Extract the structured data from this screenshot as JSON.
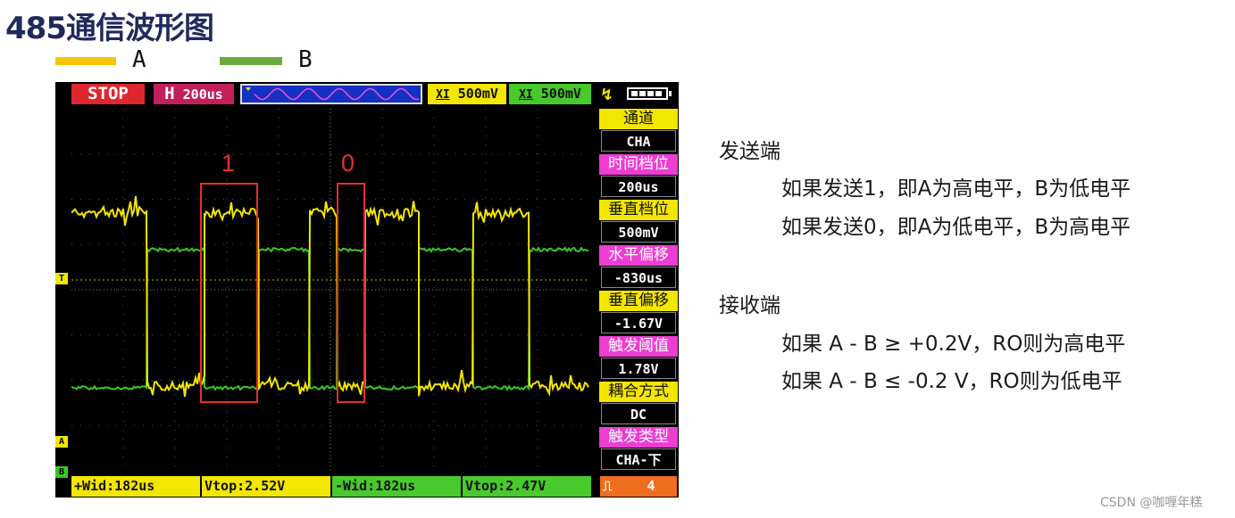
{
  "title": "485通信波形图",
  "legend": [
    {
      "label": "A",
      "color": "#f7c400"
    },
    {
      "label": "B",
      "color": "#6aab3d"
    }
  ],
  "scope": {
    "status": "STOP",
    "timebase_prefix": "H",
    "timebase": "200us",
    "ch1_scale": "500mV",
    "ch2_scale": "500mV",
    "ch_prefix": "XI",
    "marker_trigger": "T",
    "marker_a": "A",
    "marker_b": "B",
    "bit_label_1": "1",
    "bit_label_0": "0",
    "colors": {
      "ch_a": "#f3e600",
      "ch_b": "#3cc52b",
      "highlight": "#e5302a",
      "grid": "#555555"
    },
    "panel": [
      {
        "label": "通道",
        "value": "CHA",
        "label_bg": "#f3e600"
      },
      {
        "label": "时间档位",
        "value": "200us",
        "label_bg": "#ec3ed2"
      },
      {
        "label": "垂直档位",
        "value": "500mV",
        "label_bg": "#f3e600"
      },
      {
        "label": "水平偏移",
        "value": "-830us",
        "label_bg": "#ec3ed2"
      },
      {
        "label": "垂直偏移",
        "value": "-1.67V",
        "label_bg": "#f3e600"
      },
      {
        "label": "触发阈值",
        "value": "1.78V",
        "label_bg": "#ec3ed2"
      },
      {
        "label": "耦合方式",
        "value": "DC",
        "label_bg": "#f3e600"
      },
      {
        "label": "触发类型",
        "value": "CHA-下",
        "label_bg": "#ec3ed2"
      }
    ],
    "bottom": {
      "pwid": "+Wid:182us",
      "vtop_a": "Vtop:2.52V",
      "nwid": "-Wid:182us",
      "vtop_b": "Vtop:2.47V",
      "count_icon": "⎍",
      "count": "4"
    }
  },
  "notes": {
    "send_heading": "发送端",
    "send_line1": "如果发送1，即A为高电平，B为低电平",
    "send_line2": "如果发送0，即A为低电平，B为高电平",
    "recv_heading": "接收端",
    "recv_line1": "如果 A - B ≥ +0.2V，RO则为高电平",
    "recv_line2": "如果 A - B ≤ -0.2  V，RO则为低电平"
  },
  "credit": "CSDN @咖喱年糕"
}
